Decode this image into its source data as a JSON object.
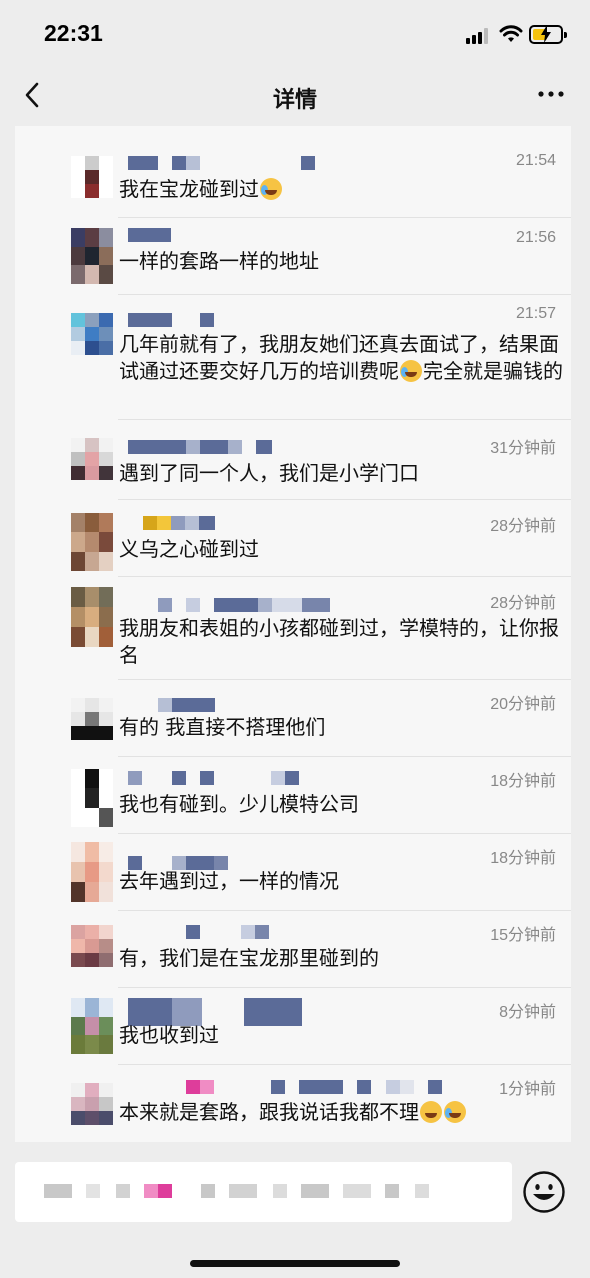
{
  "status_bar": {
    "time": "22:31"
  },
  "nav": {
    "title": "详情"
  },
  "comments": [
    {
      "time": "21:54",
      "text": "我在宝龙碰到过",
      "emojis": [
        "laugh-cry-emoji"
      ]
    },
    {
      "time": "21:56",
      "text": "一样的套路一样的地址",
      "emojis": []
    },
    {
      "time": "21:57",
      "text_before": "几年前就有了，我朋友她们还真去面试了，结果面试通过还要交好几万的培训费呢",
      "text_after": "完全就是骗钱的",
      "emojis": [
        "loudly-crying-emoji"
      ]
    },
    {
      "time": "31分钟前",
      "text": "遇到了同一个人，我们是小学门口",
      "emojis": []
    },
    {
      "time": "28分钟前",
      "text": "义乌之心碰到过",
      "emojis": []
    },
    {
      "time": "28分钟前",
      "text": "我朋友和表姐的小孩都碰到过，学模特的，让你报名",
      "emojis": []
    },
    {
      "time": "20分钟前",
      "text": "有的  我直接不搭理他们",
      "emojis": []
    },
    {
      "time": "18分钟前",
      "text": "我也有碰到。少儿模特公司",
      "emojis": []
    },
    {
      "time": "18分钟前",
      "text": "去年遇到过，一样的情况",
      "emojis": []
    },
    {
      "time": "15分钟前",
      "text": "有，我们是在宝龙那里碰到的",
      "emojis": []
    },
    {
      "time": "8分钟前",
      "text": "我也收到过",
      "emojis": []
    },
    {
      "time": "1分钟前",
      "text": "本来就是套路，跟我说话我都不理",
      "emojis": [
        "thinking-emoji",
        "loudly-crying-emoji"
      ]
    }
  ],
  "colors": {
    "background": "#ededed",
    "card": "#f7f7f7",
    "name_blur": "#5b6b98",
    "time_text": "#888888",
    "battery": "#f4c20d"
  }
}
